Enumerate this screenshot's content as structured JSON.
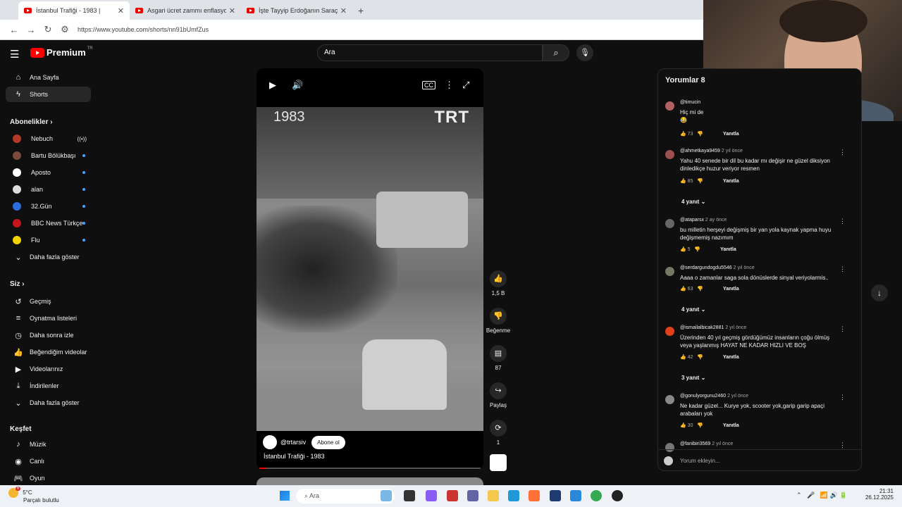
{
  "browser": {
    "tabs": [
      {
        "title": "İstanbul Trafiği - 1983 |",
        "active": true
      },
      {
        "title": "Asgari ücret zammı enflasyonu",
        "active": false
      },
      {
        "title": "İşte Tayyip Erdoğanın Saraçoğlu",
        "active": false
      }
    ],
    "new_tab": "+",
    "url": "https://www.youtube.com/shorts/nn91bUmfZus"
  },
  "masthead": {
    "brand": "Premium",
    "country": "TR",
    "search_placeholder": "Ara"
  },
  "sidebar": {
    "main": [
      {
        "label": "Ana Sayfa",
        "icon": "home-icon"
      },
      {
        "label": "Shorts",
        "icon": "shorts-icon",
        "active": true
      }
    ],
    "subscriptions_header": "Abonelikler",
    "subscriptions": [
      {
        "label": "Nebuch",
        "color": "#b33a2a",
        "live": true
      },
      {
        "label": "Bartu Bölükbaşı",
        "color": "#7a4a3a",
        "dot": true
      },
      {
        "label": "Aposto",
        "color": "#ffffff",
        "dot": true
      },
      {
        "label": "alan",
        "color": "#dddddd",
        "dot": true
      },
      {
        "label": "32.Gün",
        "color": "#2d6cdf",
        "dot": true
      },
      {
        "label": "BBC News Türkçe",
        "color": "#c4161c",
        "dot": true
      },
      {
        "label": "Flu",
        "color": "#f2d400",
        "dot": true
      }
    ],
    "subs_more": "Daha fazla göster",
    "you_header": "Siz",
    "you": [
      {
        "label": "Geçmiş",
        "icon": "history-icon"
      },
      {
        "label": "Oynatma listeleri",
        "icon": "playlist-icon"
      },
      {
        "label": "Daha sonra izle",
        "icon": "watch-later-icon"
      },
      {
        "label": "Beğendiğim videolar",
        "icon": "like-icon"
      },
      {
        "label": "Videolarınız",
        "icon": "your-videos-icon"
      },
      {
        "label": "İndirilenler",
        "icon": "download-icon"
      },
      {
        "label": "Daha fazla göster",
        "icon": "chevron-down-icon"
      }
    ],
    "explore_header": "Keşfet",
    "explore": [
      {
        "label": "Müzik",
        "icon": "music-icon"
      },
      {
        "label": "Canlı",
        "icon": "live-icon"
      },
      {
        "label": "Oyun",
        "icon": "gaming-icon"
      }
    ]
  },
  "player": {
    "overlay_year": "1983",
    "overlay_brand": "TRT",
    "channel": "@trtarsiv",
    "subscribe_label": "Abone ol",
    "title": "İstanbul Trafiği - 1983",
    "progress": 0.03
  },
  "actions": {
    "likes": "1,5 B",
    "dislike_label": "Beğenme",
    "comments": "87",
    "share_label": "Paylaş",
    "remix": "1"
  },
  "comments": {
    "title": "Yorumlar 8",
    "add_placeholder": "Yorum ekleyin...",
    "reply_label": "Yanıtla",
    "items": [
      {
        "author": "@timucin",
        "time": "",
        "text": "Hiç mi de",
        "extra": "😂",
        "likes": "73",
        "color": "#b06060"
      },
      {
        "author": "@ahmetkaya9459",
        "time": "2 yıl önce",
        "text": "Yahu 40 senede bir dil bu kadar mı değişir ne güzel diksiyon dinledikçe huzur veriyor resmen",
        "likes": "85",
        "replies": "4 yanıt",
        "color": "#9c5050"
      },
      {
        "author": "@ataparsx",
        "time": "2 ay önce",
        "text": "bu milletin herşeyi değişmiş bir yan yola kaynak yapma huyu değişmemiş nazımım",
        "likes": "5",
        "color": "#666666"
      },
      {
        "author": "@serdargundogdu5546",
        "time": "2 yıl önce",
        "text": "Aaaa o zamanlar saga sola dönüslerde sinyal veriyolarmis..",
        "likes": "63",
        "replies": "4 yanıt",
        "color": "#777766"
      },
      {
        "author": "@ismailalbicak2881",
        "time": "2 yıl önce",
        "text": "Üzerinden 40 yıl geçmiş gördüğümüz insanların çoğu ölmüş veya yaşlanmış HAYAT NE KADAR HIZLI VE BOŞ",
        "likes": "42",
        "replies": "3 yanıt",
        "color": "#e0401a"
      },
      {
        "author": "@gonulyorgunu2460",
        "time": "2 yıl önce",
        "text": "Ne kadar güzel... Kurye yok, scooter yok,garip garip apaçi arabaları yok",
        "likes": "30",
        "color": "#888888"
      },
      {
        "author": "@fanibiri3569",
        "time": "2 yıl önce",
        "text": "",
        "likes": "",
        "color": "#777777"
      }
    ]
  },
  "taskbar": {
    "temp": "5°C",
    "condition": "Parçalı bulutlu",
    "search": "Ara",
    "time": "21:31",
    "date": "26.12.2025",
    "badge": "6"
  }
}
